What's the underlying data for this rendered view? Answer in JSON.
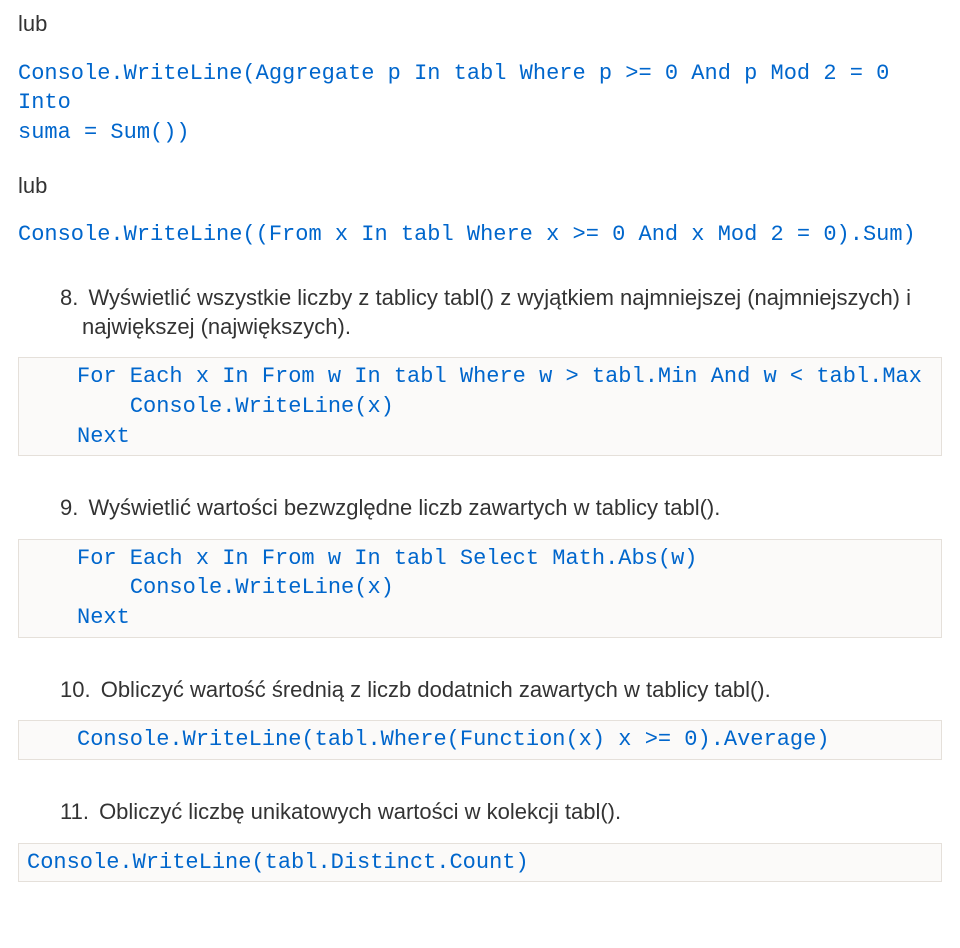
{
  "l1_lub": "lub",
  "code1_l1": "Console.WriteLine(Aggregate p In tabl Where p >= 0 And p Mod 2 = 0 Into",
  "code1_l2": "suma = Sum())",
  "l2_lub": "lub",
  "code2_l1": "Console.WriteLine((From x In tabl Where x >= 0 And x Mod 2 = 0).Sum)",
  "q8_num": "8.",
  "q8_text": " Wyświetlić wszystkie liczby z tablicy tabl() z wyjątkiem najmniejszej (najmniejszych) i największej (największych).",
  "code8_l1": "For Each x In From w In tabl Where w > tabl.Min And w < tabl.Max",
  "code8_l2": "    Console.WriteLine(x)",
  "code8_l3": "Next",
  "q9_num": "9.",
  "q9_text": " Wyświetlić wartości bezwzględne liczb zawartych w tablicy tabl().",
  "code9_l1": "For Each x In From w In tabl Select Math.Abs(w)",
  "code9_l2": "    Console.WriteLine(x)",
  "code9_l3": "Next",
  "q10_num": "10.",
  "q10_text": " Obliczyć wartość średnią z liczb dodatnich zawartych w tablicy tabl().",
  "code10_l1": "Console.WriteLine(tabl.Where(Function(x) x >= 0).Average)",
  "q11_num": "11.",
  "q11_text": " Obliczyć liczbę unikatowych wartości w kolekcji tabl().",
  "code11_l1": "Console.WriteLine(tabl.Distinct.Count)"
}
